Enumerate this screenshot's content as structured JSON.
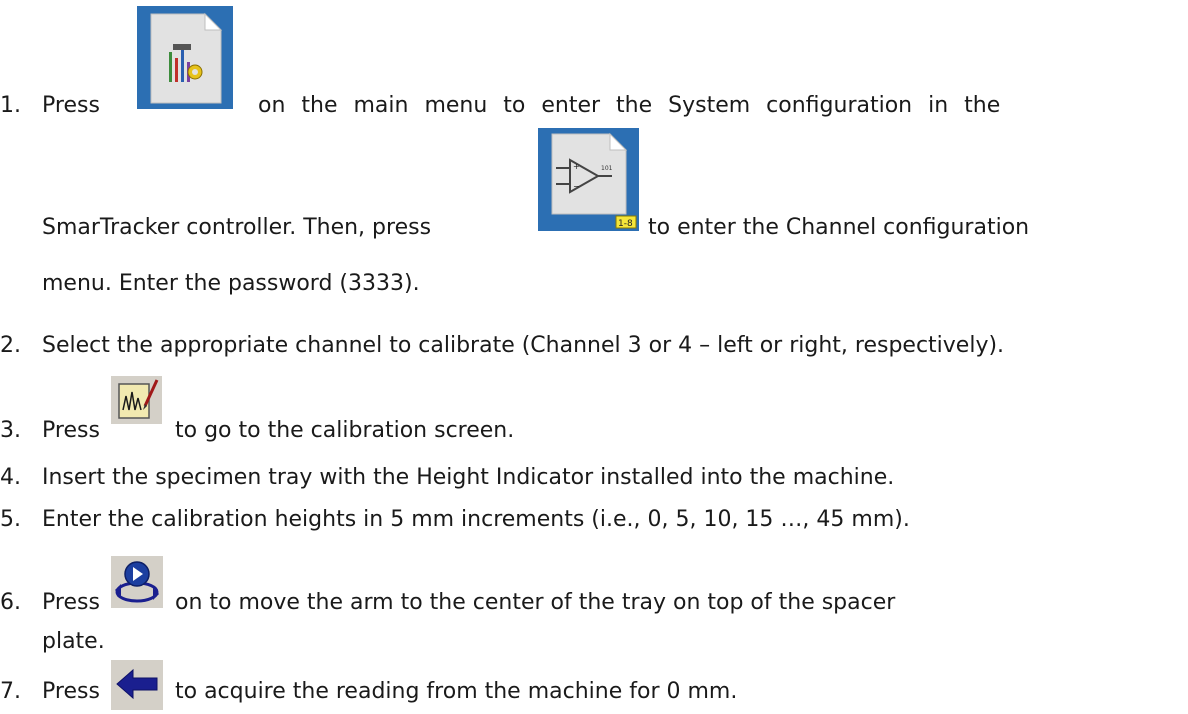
{
  "steps": [
    {
      "num": "1.",
      "a": "Press",
      "b": "on the main menu to enter the System configuration in the",
      "c": "SmarTracker controller. Then, press",
      "d": "to enter the Channel configuration",
      "e": "menu. Enter the password (3333)."
    },
    {
      "num": "2.",
      "text": "Select the appropriate channel to calibrate (Channel 3 or 4 – left or right, respectively)."
    },
    {
      "num": "3.",
      "a": "Press",
      "b": "to go to the calibration screen."
    },
    {
      "num": "4.",
      "text": "Insert the specimen tray with the Height Indicator installed into the machine."
    },
    {
      "num": "5.",
      "text": "Enter the calibration heights in 5 mm increments (i.e., 0, 5, 10, 15 …, 45 mm)."
    },
    {
      "num": "6.",
      "a": "Press",
      "b": "on to move the arm to the center of the tray on top of the spacer",
      "c": "plate."
    },
    {
      "num": "7.",
      "a": "Press",
      "b": "to acquire the reading from the machine for 0 mm."
    }
  ],
  "icons": {
    "system_config": "system-config-icon",
    "channel_config": "channel-config-icon",
    "channel_badge": "1-8",
    "calibration": "calibration-icon",
    "move_arm": "move-arm-icon",
    "acquire": "acquire-reading-icon"
  },
  "colors": {
    "icon_tile_blue": "#2c6fb3",
    "arrow_navy": "#1a1f8f"
  }
}
